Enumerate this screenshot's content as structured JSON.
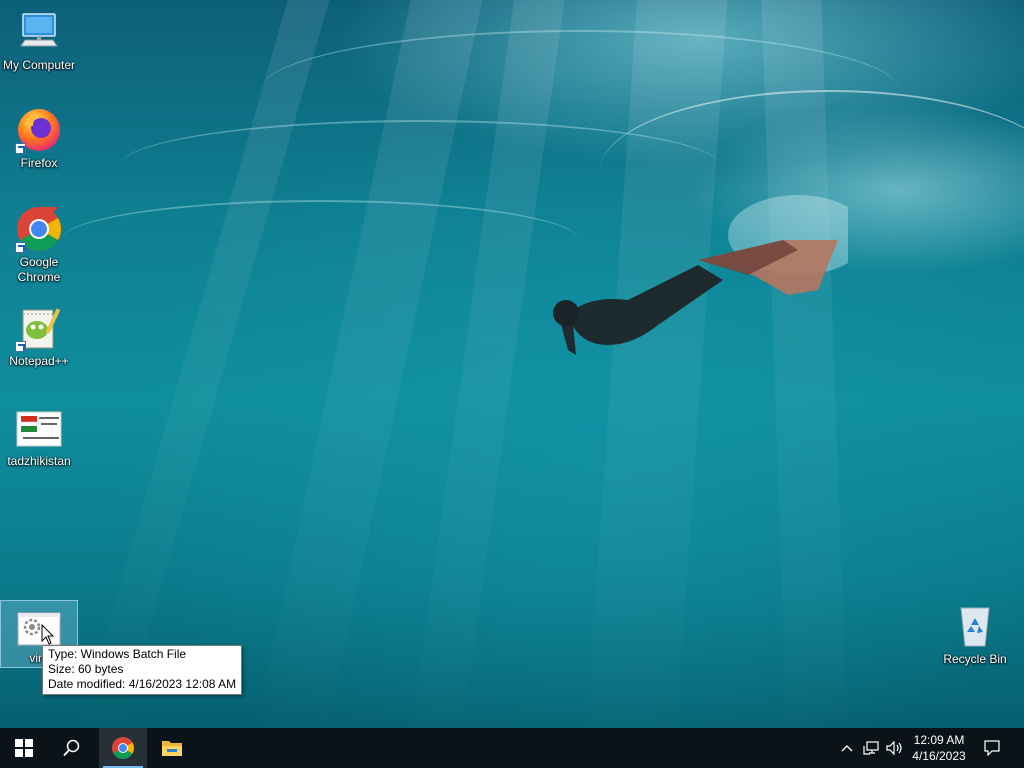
{
  "desktop_icons": [
    {
      "label": "My Computer",
      "icon": "computer-icon"
    },
    {
      "label": "Firefox",
      "icon": "firefox-icon"
    },
    {
      "label": "Google Chrome",
      "icon": "chrome-icon"
    },
    {
      "label": "Notepad++",
      "icon": "notepadpp-icon"
    },
    {
      "label": "tadzhikistan",
      "icon": "image-file-icon"
    },
    {
      "label": "viru",
      "icon": "batch-file-icon"
    },
    {
      "label": "Recycle Bin",
      "icon": "recycle-bin-icon"
    }
  ],
  "tooltip": {
    "type": "Type: Windows Batch File",
    "size": "Size: 60 bytes",
    "modified": "Date modified: 4/16/2023 12:08 AM"
  },
  "taskbar": {
    "buttons": [
      "start-icon",
      "search-icon",
      "chrome-icon",
      "file-explorer-icon"
    ],
    "tray_icons": [
      "chevron-up-icon",
      "network-icon",
      "volume-icon"
    ],
    "time": "12:09 AM",
    "date": "4/16/2023",
    "accent": "#76b9ed"
  }
}
